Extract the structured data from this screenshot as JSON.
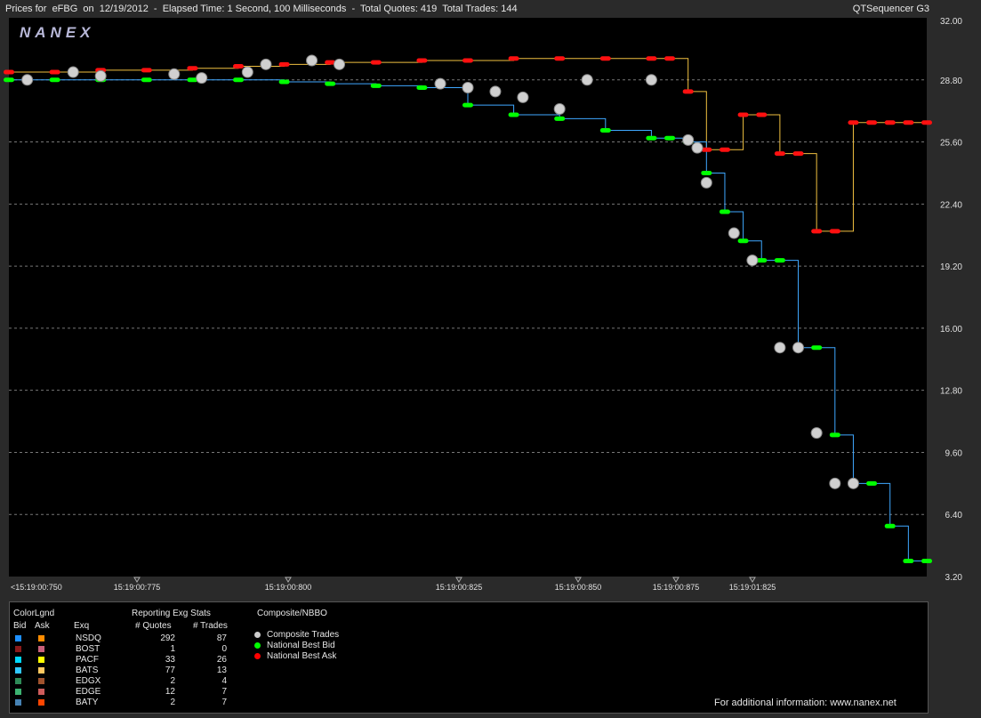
{
  "header": {
    "title": "Prices for  eFBG  on  12/19/2012  -  Elapsed Time: 1 Second, 100 Milliseconds  -  Total Quotes: 419  Total Trades: 144",
    "app_name": "QTSequencer G3"
  },
  "logo_text": "NANEX",
  "chart_data": {
    "type": "line",
    "title": "Prices for eFBG on 12/19/2012",
    "ylim": [
      3.2,
      32.0
    ],
    "y_ticks": [
      "32.00",
      "28.80",
      "25.60",
      "22.40",
      "19.20",
      "16.00",
      "12.80",
      "9.60",
      "6.40",
      "3.20"
    ],
    "x_ticks": [
      "<15:19:00:750",
      "15:19:00:775",
      "15:19:00:800",
      "15:19:00:825",
      "15:19:00:850",
      "15:19:00:875",
      "15:19:01:825"
    ],
    "grid": true,
    "series": [
      {
        "name": "National Best Bid",
        "x": [
          0,
          5,
          10,
          15,
          20,
          25,
          30,
          35,
          40,
          45,
          50,
          55,
          60,
          65,
          70,
          72,
          74,
          76,
          78,
          80,
          82,
          84,
          86,
          88,
          90,
          92,
          94,
          96,
          98,
          100
        ],
        "values": [
          28.8,
          28.8,
          28.8,
          28.8,
          28.8,
          28.8,
          28.7,
          28.6,
          28.5,
          28.4,
          27.5,
          27.0,
          26.8,
          26.2,
          25.8,
          25.8,
          25.6,
          24.0,
          22.0,
          20.5,
          19.5,
          19.5,
          15.0,
          15.0,
          10.5,
          8.0,
          8.0,
          5.8,
          4.0,
          4.0
        ]
      },
      {
        "name": "National Best Ask",
        "x": [
          0,
          5,
          10,
          15,
          20,
          25,
          30,
          35,
          40,
          45,
          50,
          55,
          60,
          65,
          70,
          72,
          74,
          76,
          78,
          80,
          82,
          84,
          86,
          88,
          90,
          92,
          94,
          96,
          98,
          100
        ],
        "values": [
          29.2,
          29.2,
          29.3,
          29.3,
          29.4,
          29.5,
          29.6,
          29.7,
          29.7,
          29.8,
          29.8,
          29.9,
          29.9,
          29.9,
          29.9,
          29.9,
          28.2,
          25.2,
          25.2,
          27.0,
          27.0,
          25.0,
          25.0,
          21.0,
          21.0,
          26.6,
          26.6,
          26.6,
          26.6,
          26.6
        ]
      },
      {
        "name": "Composite Trades",
        "x": [
          2,
          7,
          10,
          18,
          21,
          26,
          28,
          33,
          36,
          47,
          50,
          53,
          56,
          60,
          63,
          70,
          74,
          75,
          76,
          79,
          81,
          84,
          86,
          88,
          90,
          92
        ],
        "values": [
          28.8,
          29.2,
          29.0,
          29.1,
          28.9,
          29.2,
          29.6,
          29.8,
          29.6,
          28.6,
          28.4,
          28.2,
          27.9,
          27.3,
          28.8,
          28.8,
          25.7,
          25.3,
          23.5,
          20.9,
          19.5,
          15.0,
          15.0,
          10.6,
          8.0,
          8.0
        ]
      }
    ]
  },
  "legend": {
    "color_legend_title": "ColorLgnd",
    "bid_label": "Bid",
    "ask_label": "Ask",
    "exq_label": "Exq",
    "stats_title": "Reporting Exg Stats",
    "quotes_label": "# Quotes",
    "trades_label": "# Trades",
    "composite_title": "Composite/NBBO",
    "exchanges": [
      {
        "name": "NSDQ",
        "quotes": "292",
        "trades": "87",
        "bid_color": "#1e90ff",
        "ask_color": "#ff8c00"
      },
      {
        "name": "BOST",
        "quotes": "1",
        "trades": "0",
        "bid_color": "#8b1a1a",
        "ask_color": "#c8607a"
      },
      {
        "name": "PACF",
        "quotes": "33",
        "trades": "26",
        "bid_color": "#00d8ff",
        "ask_color": "#ffff00"
      },
      {
        "name": "BATS",
        "quotes": "77",
        "trades": "13",
        "bid_color": "#30c8ff",
        "ask_color": "#ffc860"
      },
      {
        "name": "EDGX",
        "quotes": "2",
        "trades": "4",
        "bid_color": "#2e8b57",
        "ask_color": "#a0522d"
      },
      {
        "name": "EDGE",
        "quotes": "12",
        "trades": "7",
        "bid_color": "#3cb371",
        "ask_color": "#cd5c5c"
      },
      {
        "name": "BATY",
        "quotes": "2",
        "trades": "7",
        "bid_color": "#4682b4",
        "ask_color": "#ff4500"
      }
    ],
    "composite_items": [
      {
        "label": "Composite Trades",
        "color": "#cccccc"
      },
      {
        "label": "National Best Bid",
        "color": "#00ff00"
      },
      {
        "label": "National Best Ask",
        "color": "#ff0000"
      }
    ]
  },
  "footer_text": "For additional information: www.nanex.net"
}
